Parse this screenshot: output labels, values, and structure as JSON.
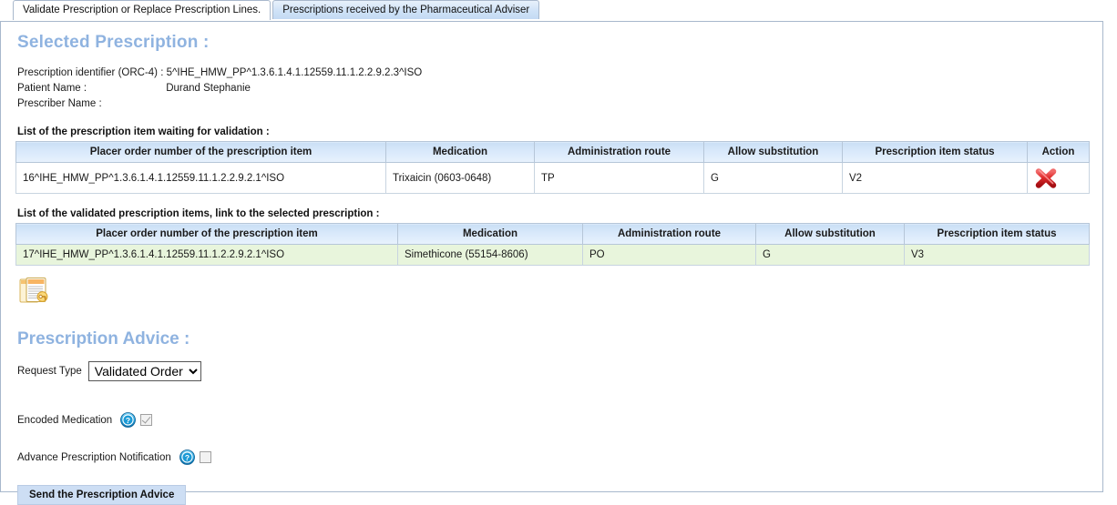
{
  "tabs": [
    {
      "label": "Validate Prescription or Replace Prescription Lines.",
      "active": true,
      "name": "tab-validate-prescription"
    },
    {
      "label": "Prescriptions received by the Pharmaceutical Adviser",
      "active": false,
      "name": "tab-prescriptions-received"
    }
  ],
  "selected_prescription": {
    "title": "Selected Prescription :",
    "fields": [
      {
        "label": "Prescription identifier (ORC-4) :",
        "value": "5^IHE_HMW_PP^1.3.6.1.4.1.12559.11.1.2.2.9.2.3^ISO"
      },
      {
        "label": "Patient Name :",
        "value": "Durand Stephanie"
      },
      {
        "label": "Prescriber Name :",
        "value": ""
      }
    ]
  },
  "pending_table": {
    "caption": "List of the prescription item waiting for validation :",
    "columns": [
      "Placer order number of the prescription item",
      "Medication",
      "Administration route",
      "Allow substitution",
      "Prescription item status",
      "Action"
    ],
    "rows": [
      {
        "placer_order_number": "16^IHE_HMW_PP^1.3.6.1.4.1.12559.11.1.2.2.9.2.1^ISO",
        "medication": "Trixaicin (0603-0648)",
        "administration_route": "TP",
        "allow_substitution": "G",
        "status": "V2",
        "action_icon": "delete-x-icon"
      }
    ]
  },
  "validated_table": {
    "caption": "List of the validated prescription items, link to the selected prescription :",
    "columns": [
      "Placer order number of the prescription item",
      "Medication",
      "Administration route",
      "Allow substitution",
      "Prescription item status"
    ],
    "rows": [
      {
        "placer_order_number": "17^IHE_HMW_PP^1.3.6.1.4.1.12559.11.1.2.2.9.2.1^ISO",
        "medication": "Simethicone (55154-8606)",
        "administration_route": "PO",
        "allow_substitution": "G",
        "status": "V3"
      }
    ]
  },
  "form_icon": "prescription-form-icon",
  "prescription_advice": {
    "title": "Prescription Advice :",
    "request_type": {
      "label": "Request Type",
      "value": "Validated Order",
      "options": [
        "Validated Order"
      ]
    },
    "checkboxes": [
      {
        "label": "Encoded Medication",
        "checked": true,
        "help_icon": "help-icon"
      },
      {
        "label": "Advance Prescription Notification",
        "checked": false,
        "help_icon": "help-icon"
      }
    ],
    "submit_label": "Send the Prescription Advice"
  },
  "colors": {
    "section_title": "#8fb3e0",
    "table_header": "#cadff5",
    "validated_row": "#e8f5dc",
    "button": "#cddef4",
    "action_x": "#d81f26",
    "help_icon": "#1b9ad6"
  }
}
